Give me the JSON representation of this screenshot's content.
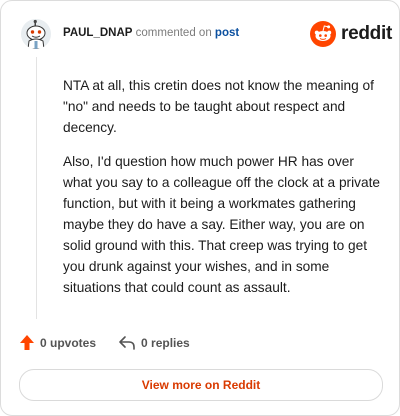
{
  "header": {
    "username": "PAUL_DNAP",
    "action_text": "commented on",
    "post_link": "post"
  },
  "logo": {
    "wordmark": "reddit",
    "icon": "reddit-snoo-icon",
    "color": "#ff4500"
  },
  "comment": {
    "paragraphs": [
      "NTA at all, this cretin does not know the meaning of \"no\" and needs to be taught about respect and decency.",
      "Also, I'd question how much power HR has over what you say to a colleague off the clock at a private function, but with it being a workmates gathering maybe they do have a say. Either way, you are on solid ground with this. That creep was trying to get you drunk against your wishes, and in some situations that could count as assault."
    ]
  },
  "actions": {
    "upvotes_label": "0 upvotes",
    "replies_label": "0 replies",
    "upvote_icon": "upvote-arrow-icon",
    "reply_icon": "reply-arrow-icon"
  },
  "footer": {
    "view_more_label": "View more on Reddit"
  }
}
